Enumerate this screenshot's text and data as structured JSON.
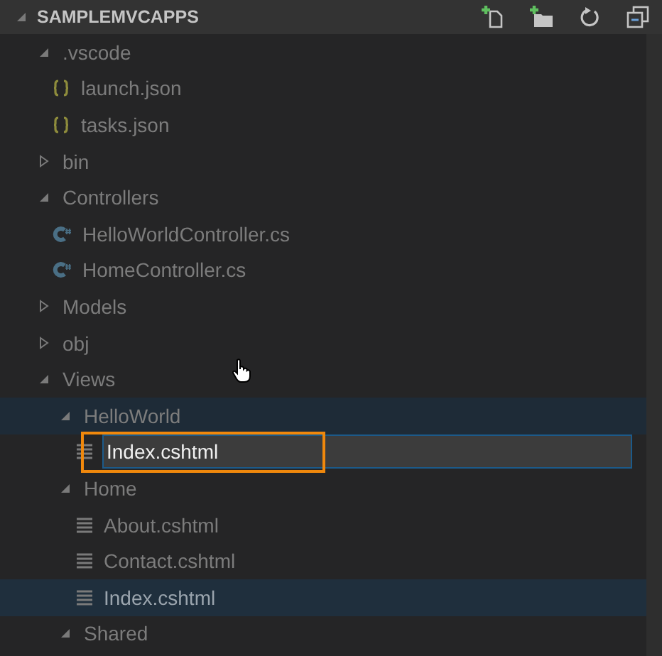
{
  "header": {
    "title": "SAMPLEMVCAPPS",
    "expanded": true
  },
  "tree": [
    {
      "kind": "folder",
      "label": ".vscode",
      "expanded": true,
      "selected": false,
      "children": [
        {
          "kind": "json-file",
          "label": "launch.json",
          "selected": false,
          "editing": false
        },
        {
          "kind": "json-file",
          "label": "tasks.json",
          "selected": false,
          "editing": false
        }
      ]
    },
    {
      "kind": "folder",
      "label": "bin",
      "expanded": false,
      "selected": false
    },
    {
      "kind": "folder",
      "label": "Controllers",
      "expanded": true,
      "selected": false,
      "children": [
        {
          "kind": "csharp-file",
          "label": "HelloWorldController.cs",
          "selected": false,
          "editing": false
        },
        {
          "kind": "csharp-file",
          "label": "HomeController.cs",
          "selected": false,
          "editing": false
        }
      ]
    },
    {
      "kind": "folder",
      "label": "Models",
      "expanded": false,
      "selected": false
    },
    {
      "kind": "folder",
      "label": "obj",
      "expanded": false,
      "selected": false
    },
    {
      "kind": "folder",
      "label": "Views",
      "expanded": true,
      "selected": false,
      "children": [
        {
          "kind": "folder",
          "label": "HelloWorld",
          "expanded": true,
          "selected": true,
          "children": [
            {
              "kind": "cshtml-file",
              "label": "Index.cshtml",
              "selected": false,
              "editing": true
            }
          ]
        },
        {
          "kind": "folder",
          "label": "Home",
          "expanded": true,
          "selected": false,
          "children": [
            {
              "kind": "cshtml-file",
              "label": "About.cshtml",
              "selected": false,
              "editing": false
            },
            {
              "kind": "cshtml-file",
              "label": "Contact.cshtml",
              "selected": false,
              "editing": false
            },
            {
              "kind": "cshtml-file",
              "label": "Index.cshtml",
              "selected": true,
              "editing": false
            }
          ]
        },
        {
          "kind": "folder",
          "label": "Shared",
          "expanded": true,
          "selected": false
        }
      ]
    }
  ]
}
